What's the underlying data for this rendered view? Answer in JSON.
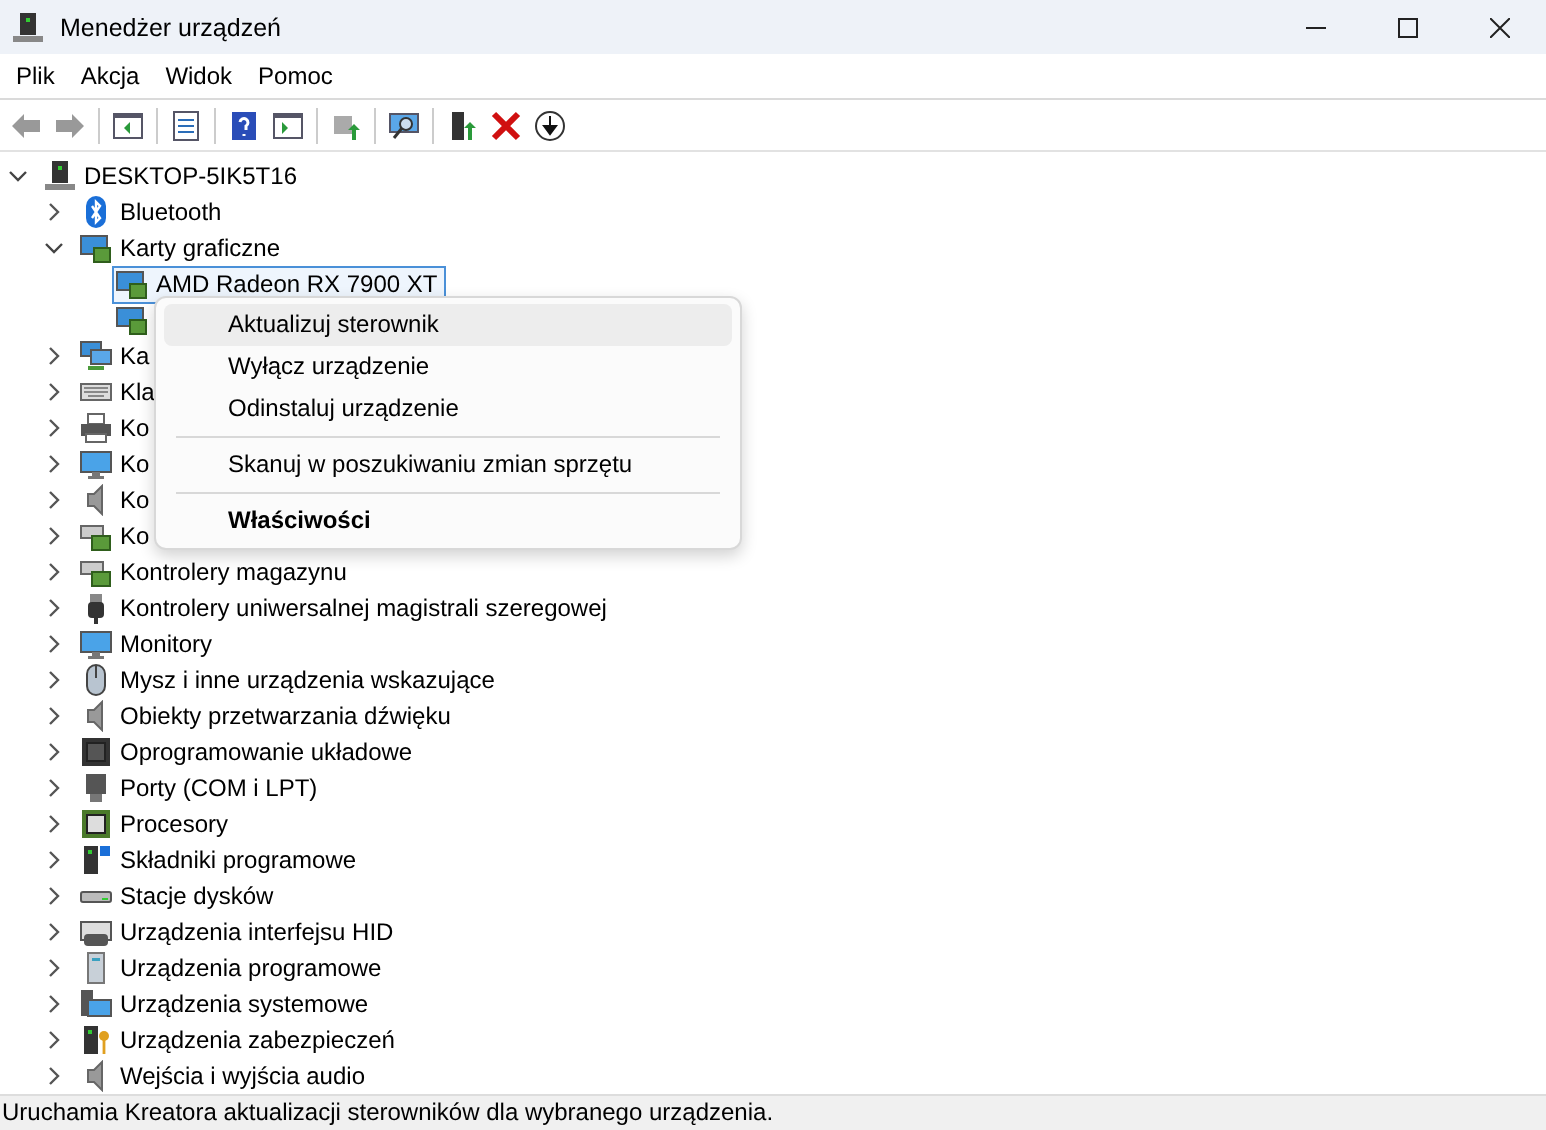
{
  "window": {
    "title": "Menedżer urządzeń"
  },
  "menu_bar": [
    "Plik",
    "Akcja",
    "Widok",
    "Pomoc"
  ],
  "toolbar": [
    {
      "disabled": true
    },
    {
      "disabled": true
    },
    {
      "disabled": false
    },
    {
      "disabled": false
    },
    {
      "disabled": false
    },
    {
      "disabled": false
    },
    {
      "disabled": false
    },
    {
      "disabled": false
    },
    {
      "disabled": false
    },
    {
      "disabled": false
    },
    {
      "disabled": false
    }
  ],
  "tree": {
    "label": "DESKTOP-5IK5T16",
    "expanded": true,
    "selected": false,
    "children": [
      {
        "label": "Bluetooth",
        "expanded": false,
        "selected": false
      },
      {
        "label": "Karty graficzne",
        "expanded": true,
        "selected": false,
        "children": [
          {
            "label": "AMD Radeon RX 7900 XT",
            "selected": true
          },
          {
            "selected": false
          }
        ]
      },
      {
        "label": "Ka",
        "expanded": false,
        "selected": false
      },
      {
        "label": "Kla",
        "expanded": false,
        "selected": false
      },
      {
        "label": "Ko",
        "expanded": false,
        "selected": false
      },
      {
        "label": "Ko",
        "expanded": false,
        "selected": false
      },
      {
        "label": "Ko",
        "expanded": false,
        "selected": false
      },
      {
        "label": "Ko",
        "expanded": false,
        "selected": false
      },
      {
        "label": "Kontrolery magazynu",
        "expanded": false,
        "selected": false
      },
      {
        "label": "Kontrolery uniwersalnej magistrali szeregowej",
        "expanded": false,
        "selected": false
      },
      {
        "label": "Monitory",
        "expanded": false,
        "selected": false
      },
      {
        "label": "Mysz i inne urządzenia wskazujące",
        "expanded": false,
        "selected": false
      },
      {
        "label": "Obiekty przetwarzania dźwięku",
        "expanded": false,
        "selected": false
      },
      {
        "label": "Oprogramowanie układowe",
        "expanded": false,
        "selected": false
      },
      {
        "label": "Porty (COM i LPT)",
        "expanded": false,
        "selected": false
      },
      {
        "label": "Procesory",
        "expanded": false,
        "selected": false
      },
      {
        "label": "Składniki programowe",
        "expanded": false,
        "selected": false
      },
      {
        "label": "Stacje dysków",
        "expanded": false,
        "selected": false
      },
      {
        "label": "Urządzenia interfejsu HID",
        "expanded": false,
        "selected": false
      },
      {
        "label": "Urządzenia programowe",
        "expanded": false,
        "selected": false
      },
      {
        "label": "Urządzenia systemowe",
        "expanded": false,
        "selected": false
      },
      {
        "label": "Urządzenia zabezpieczeń",
        "expanded": false,
        "selected": false
      },
      {
        "label": "Wejścia i wyjścia audio",
        "expanded": false,
        "selected": false
      }
    ]
  },
  "context_menu": {
    "items": [
      {
        "kind": "item",
        "label": "Aktualizuj sterownik",
        "highlighted": true
      },
      {
        "kind": "item",
        "label": "Wyłącz urządzenie",
        "highlighted": false
      },
      {
        "kind": "item",
        "label": "Odinstaluj urządzenie",
        "highlighted": false
      },
      {
        "kind": "separator"
      },
      {
        "kind": "item",
        "label": "Skanuj w poszukiwaniu zmian sprzętu",
        "highlighted": false
      },
      {
        "kind": "separator"
      },
      {
        "kind": "default",
        "label": "Właściwości",
        "highlighted": false
      }
    ]
  },
  "status_bar": "Uruchamia Kreatora aktualizacji sterowników dla wybranego urządzenia."
}
